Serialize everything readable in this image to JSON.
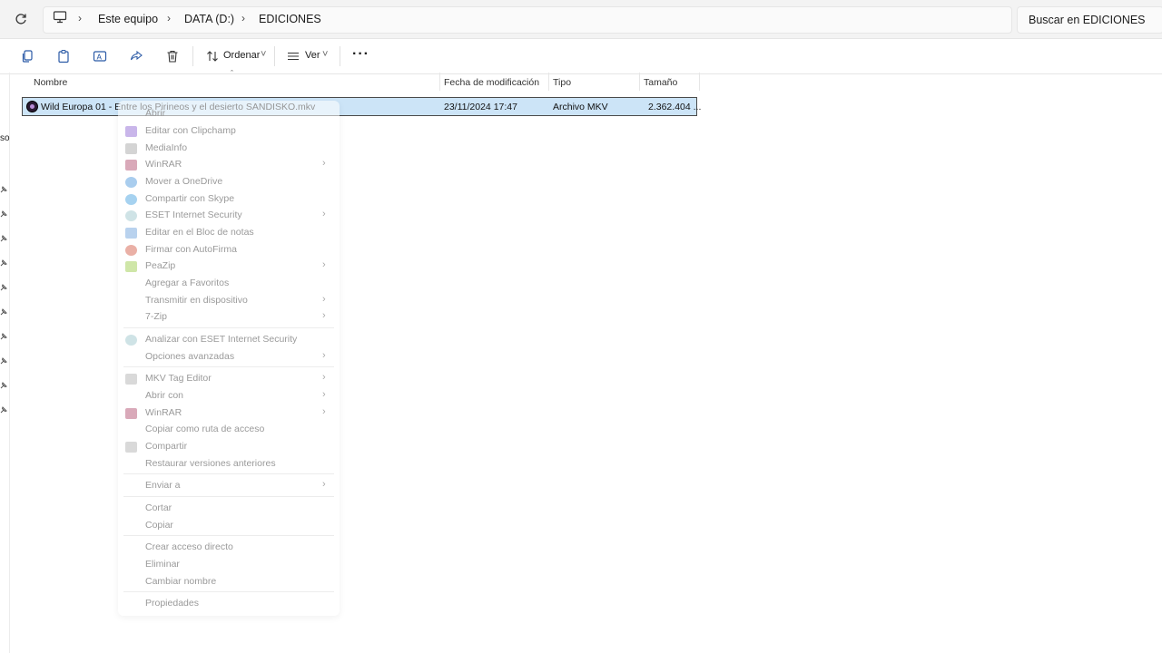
{
  "address": {
    "crumbs": [
      "Este equipo",
      "DATA (D:)",
      "EDICIONES"
    ],
    "search_placeholder": "Buscar en EDICIONES"
  },
  "toolbar": {
    "sort_label": "Ordenar",
    "view_label": "Ver"
  },
  "nav": {
    "partial_text": "so"
  },
  "columns": [
    "Nombre",
    "Fecha de modificación",
    "Tipo",
    "Tamaño"
  ],
  "file": {
    "name": "Wild Europa 01 - Entre los Pirineos y el desierto SANDISKO.mkv",
    "modified": "23/11/2024 17:47",
    "type": "Archivo MKV",
    "size": "2.362.404 ..."
  },
  "context_menu": [
    {
      "label": "Abrir",
      "icon": "none",
      "submenu": false
    },
    {
      "label": "Editar con Clipchamp",
      "icon": "clipchamp-icon",
      "submenu": false
    },
    {
      "label": "MediaInfo",
      "icon": "mediainfo-icon",
      "submenu": false
    },
    {
      "label": "WinRAR",
      "icon": "winrar-icon",
      "submenu": true
    },
    {
      "label": "Mover a OneDrive",
      "icon": "onedrive-icon",
      "submenu": false
    },
    {
      "label": "Compartir con Skype",
      "icon": "skype-icon",
      "submenu": false
    },
    {
      "label": "ESET Internet Security",
      "icon": "eset-icon",
      "submenu": true
    },
    {
      "label": "Editar en el Bloc de notas",
      "icon": "notepad-icon",
      "submenu": false
    },
    {
      "label": "Firmar con AutoFirma",
      "icon": "autofirma-icon",
      "submenu": false
    },
    {
      "label": "PeaZip",
      "icon": "peazip-icon",
      "submenu": true
    },
    {
      "label": "Agregar a Favoritos",
      "icon": "none",
      "submenu": false
    },
    {
      "label": "Transmitir en dispositivo",
      "icon": "none",
      "submenu": true
    },
    {
      "label": "7-Zip",
      "icon": "none",
      "submenu": true
    },
    {
      "label": "Analizar con ESET Internet Security",
      "icon": "eset-icon",
      "submenu": false
    },
    {
      "label": "Opciones avanzadas",
      "icon": "none",
      "submenu": true
    },
    {
      "label": "MKV Tag Editor",
      "icon": "tag-icon",
      "submenu": true
    },
    {
      "label": "Abrir con",
      "icon": "none",
      "submenu": true
    },
    {
      "label": "WinRAR",
      "icon": "winrar-icon",
      "submenu": true
    },
    {
      "label": "Copiar como ruta de acceso",
      "icon": "none",
      "submenu": false
    },
    {
      "label": "Compartir",
      "icon": "share-icon",
      "submenu": false
    },
    {
      "label": "Restaurar versiones anteriores",
      "icon": "none",
      "submenu": false
    },
    {
      "label": "Enviar a",
      "icon": "none",
      "submenu": true
    },
    {
      "label": "Cortar",
      "icon": "none",
      "submenu": false
    },
    {
      "label": "Copiar",
      "icon": "none",
      "submenu": false
    },
    {
      "label": "Crear acceso directo",
      "icon": "none",
      "submenu": false
    },
    {
      "label": "Eliminar",
      "icon": "none",
      "submenu": false
    },
    {
      "label": "Cambiar nombre",
      "icon": "none",
      "submenu": false
    },
    {
      "label": "Propiedades",
      "icon": "none",
      "submenu": false
    }
  ],
  "colors": {
    "selection": "#cce4f7",
    "menu_text": "#9a9a9a"
  }
}
